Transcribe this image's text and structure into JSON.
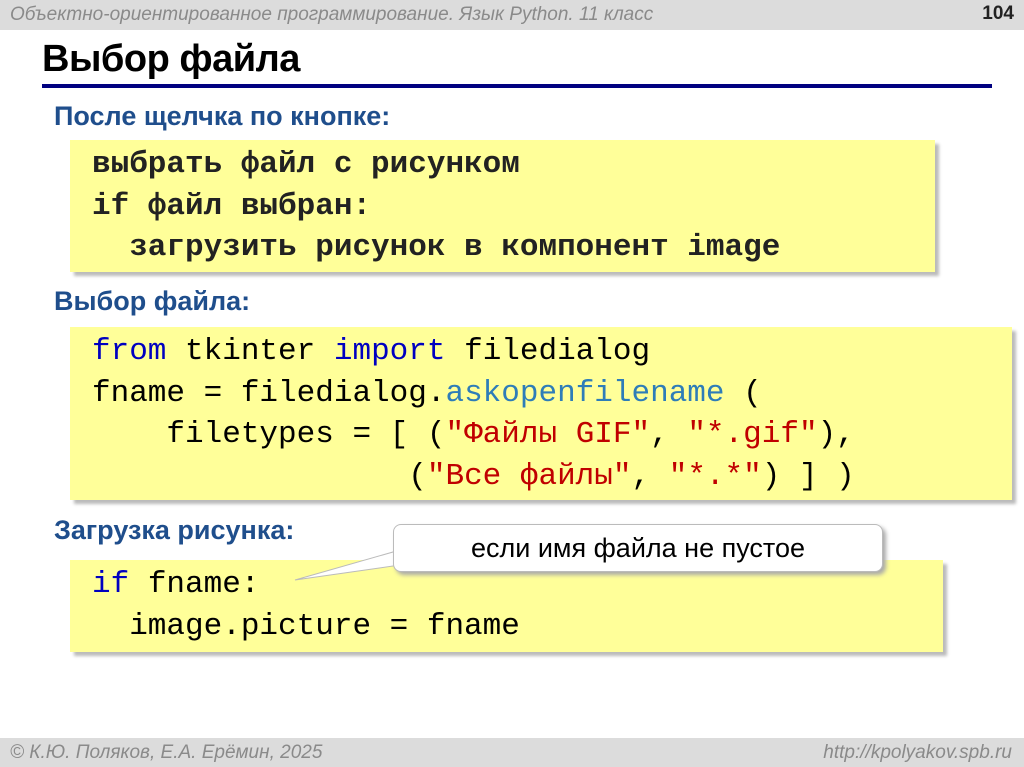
{
  "header": {
    "course": "Объектно-ориентированное программирование. Язык Python. 11 класс",
    "page_number": "104"
  },
  "title": "Выбор файла",
  "sections": [
    {
      "heading": "После щелчка по кнопке:",
      "lines": [
        "выбрать файл с рисунком",
        "if файл выбран:",
        "  загрузить рисунок в компонент image"
      ]
    },
    {
      "heading": "Выбор файла:"
    },
    {
      "heading": "Загрузка рисунка:"
    }
  ],
  "code2": {
    "l1_kw1": "from",
    "l1_mod": " tkinter ",
    "l1_kw2": "import",
    "l1_rest": " filedialog",
    "l2_a": "fname = filedialog.",
    "l2_fn": "askopenfilename",
    "l2_b": " (",
    "l3_a": "    filetypes = [ (",
    "l3_s1": "\"Файлы GIF\"",
    "l3_c": ", ",
    "l3_s2": "\"*.gif\"",
    "l3_d": "),",
    "l4_a": "                 (",
    "l4_s1": "\"Все файлы\"",
    "l4_c": ", ",
    "l4_s2": "\"*.*\"",
    "l4_d": ") ] )"
  },
  "code3": {
    "l1_kw": "if",
    "l1_rest": " fname:",
    "l2": "  image.picture = fname"
  },
  "callout": "если имя файла не пустое",
  "footer": {
    "copyright": "© К.Ю. Поляков, Е.А. Ерёмин, 2025",
    "url": "http://kpolyakov.spb.ru"
  }
}
